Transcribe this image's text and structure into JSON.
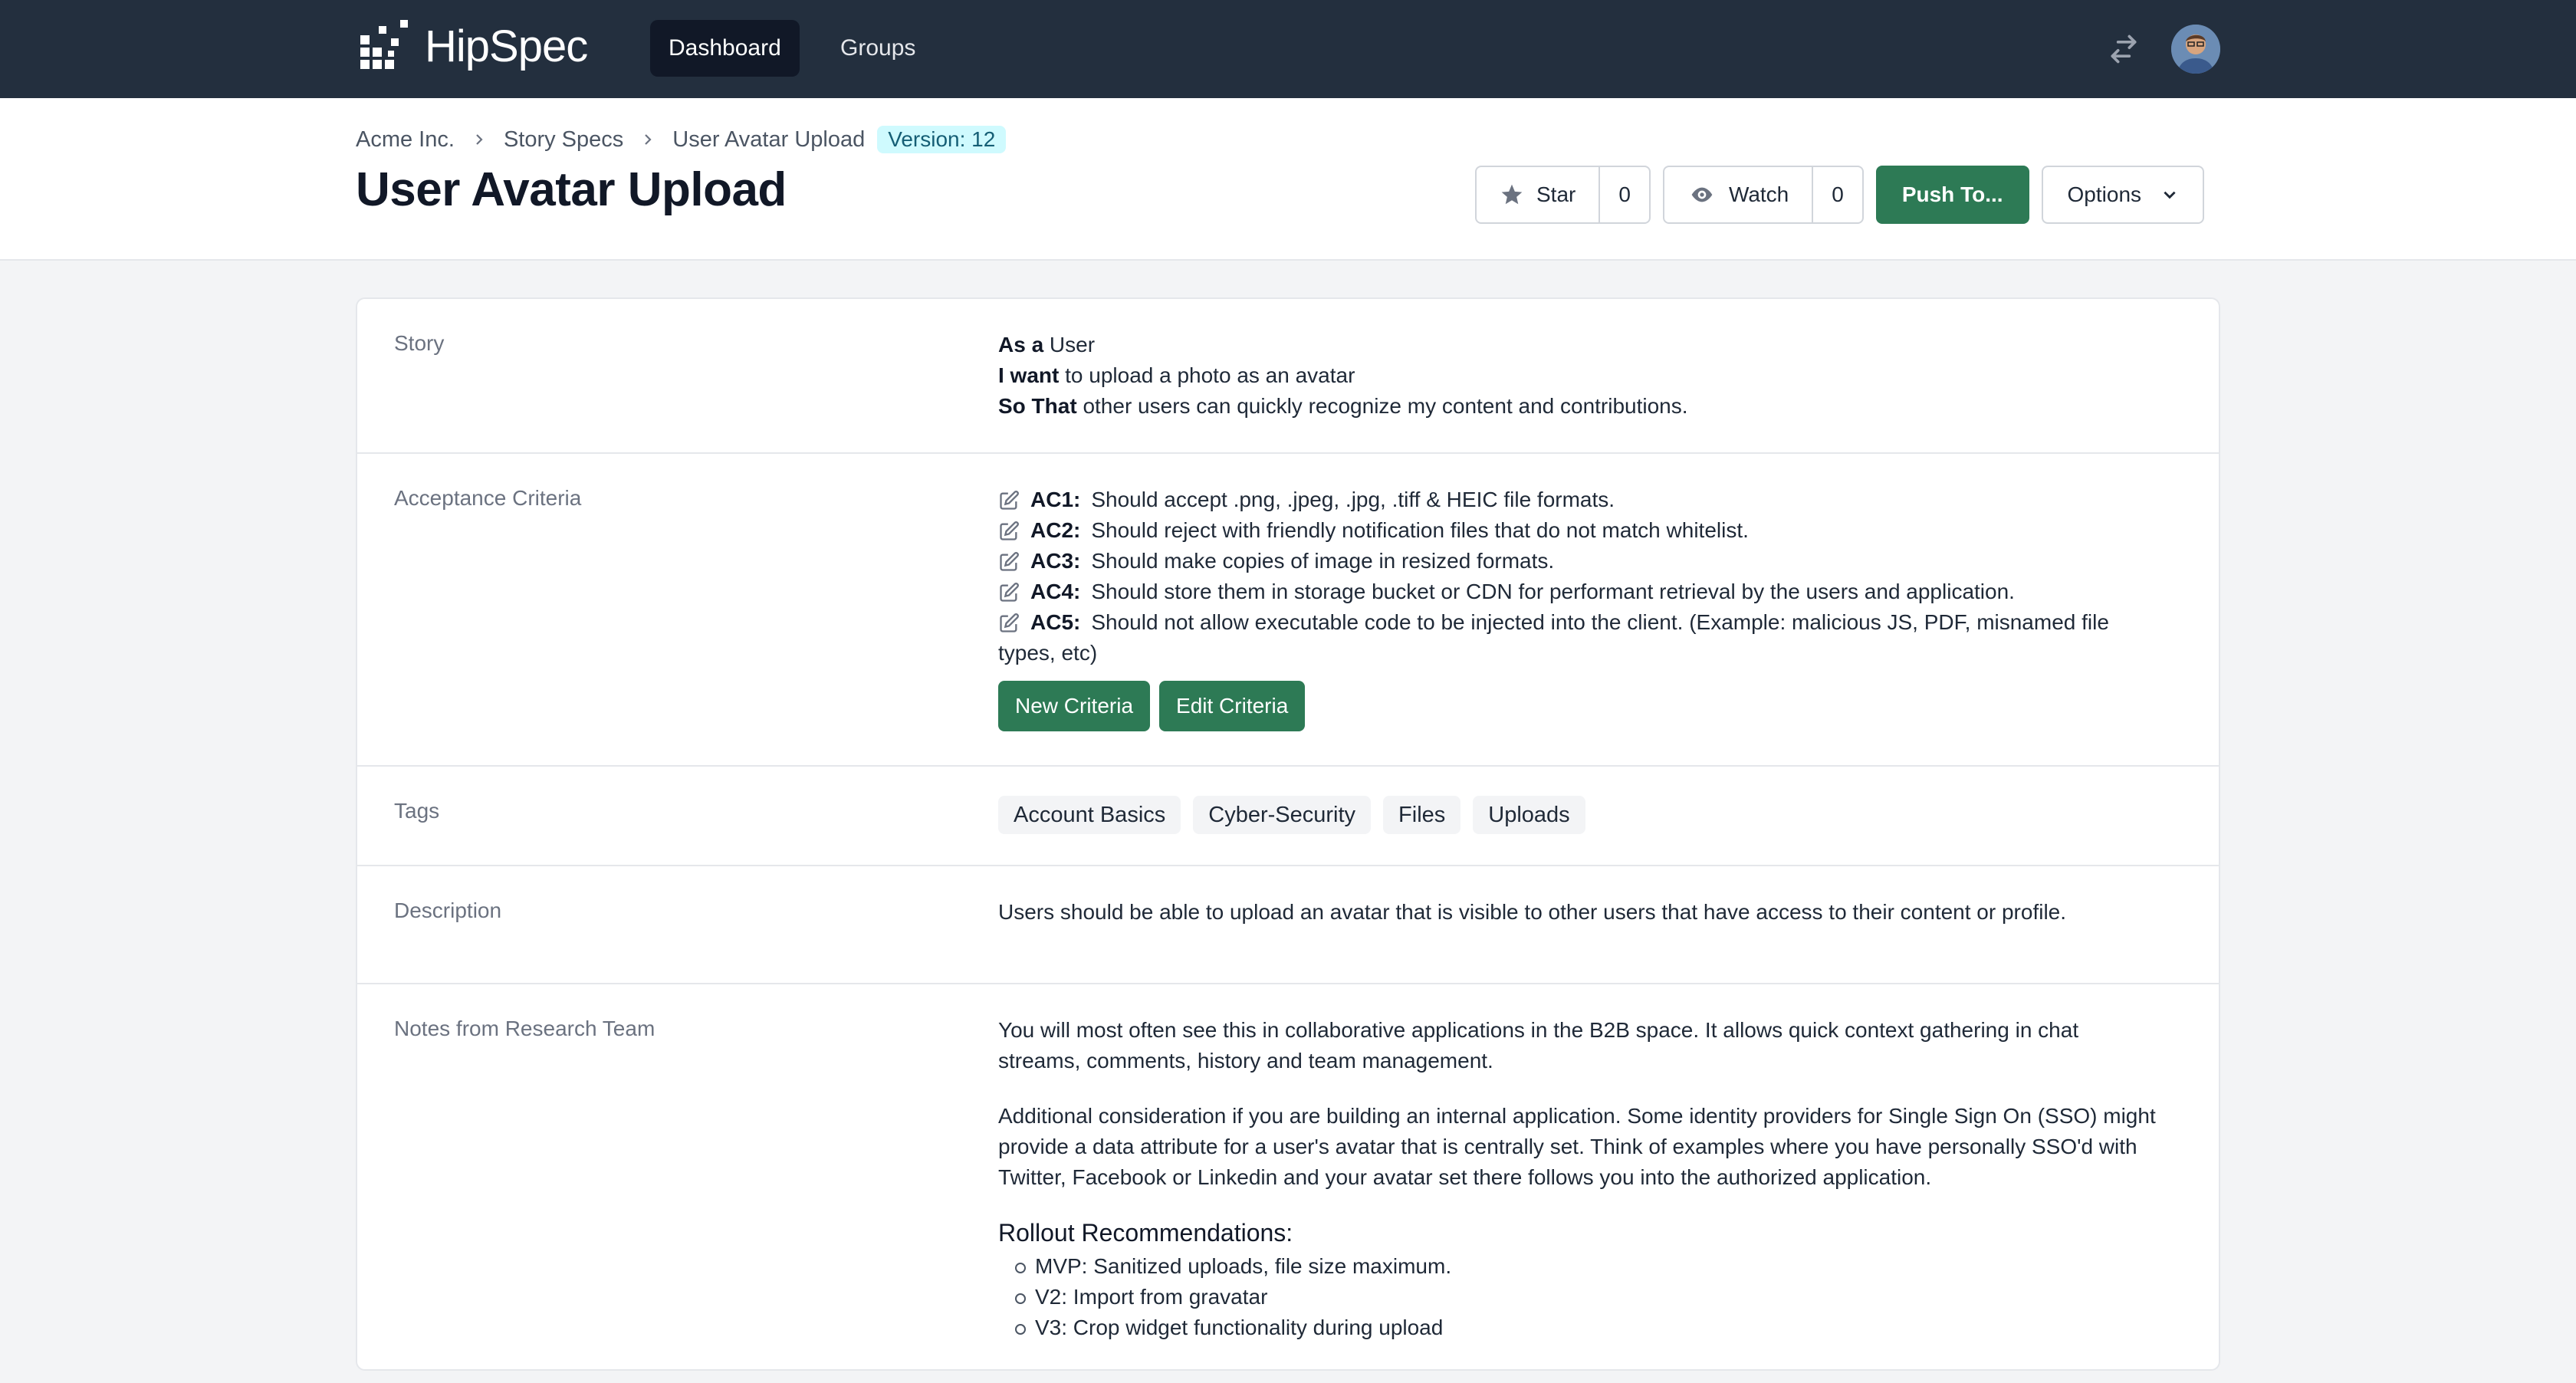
{
  "app": {
    "name": "HipSpec"
  },
  "nav": {
    "items": [
      {
        "label": "Dashboard"
      },
      {
        "label": "Groups"
      }
    ]
  },
  "breadcrumb": {
    "items": [
      "Acme Inc.",
      "Story Specs",
      "User Avatar Upload"
    ],
    "version": "Version: 12"
  },
  "page": {
    "title": "User Avatar Upload"
  },
  "actions": {
    "star_label": "Star",
    "star_count": "0",
    "watch_label": "Watch",
    "watch_count": "0",
    "push_label": "Push To...",
    "options_label": "Options"
  },
  "story": {
    "label": "Story",
    "as_a_kw": "As a",
    "as_a": " User",
    "i_want_kw": "I want",
    "i_want": " to upload a photo as an avatar",
    "so_that_kw": "So That",
    "so_that": " other users can quickly recognize my content and contributions."
  },
  "criteria": {
    "label": "Acceptance Criteria",
    "items": [
      {
        "id": "AC1:",
        "text": "Should accept .png, .jpeg, .jpg, .tiff & HEIC file formats."
      },
      {
        "id": "AC2:",
        "text": "Should reject with friendly notification files that do not match whitelist."
      },
      {
        "id": "AC3:",
        "text": "Should make copies of image in resized formats."
      },
      {
        "id": "AC4:",
        "text": "Should store them in storage bucket or CDN for performant retrieval by the users and application."
      },
      {
        "id": "AC5:",
        "text": "Should not allow executable code to be injected into the client. (Example: malicious JS, PDF, misnamed file types, etc)"
      }
    ],
    "new_label": "New Criteria",
    "edit_label": "Edit Criteria"
  },
  "tags": {
    "label": "Tags",
    "items": [
      "Account Basics",
      "Cyber-Security",
      "Files",
      "Uploads"
    ]
  },
  "description": {
    "label": "Description",
    "text": "Users should be able to upload an avatar that is visible to other users that have access to their content or profile."
  },
  "notes": {
    "label": "Notes from Research Team",
    "p1": "You will most often see this in collaborative applications in the B2B space. It allows quick context gathering in chat streams, comments, history and team management.",
    "p2": "Additional consideration if you are building an internal application. Some identity providers for Single Sign On (SSO) might provide a data attribute for a user's avatar that is centrally set. Think of examples where you have personally SSO'd with Twitter, Facebook or Linkedin and your avatar set there follows you into the authorized application.",
    "rollout_title": "Rollout Recommendations:",
    "rollout": [
      "MVP: Sanitized uploads, file size maximum.",
      "V2: Import from gravatar",
      "V3: Crop widget functionality during upload"
    ]
  },
  "colors": {
    "nav_bg": "#232f3e",
    "primary": "#2d7a55",
    "badge_bg": "#cffafe"
  },
  "icons": [
    "logo-icon",
    "swap-arrows-icon",
    "chevron-right-icon",
    "star-icon",
    "eye-icon",
    "chevron-down-icon",
    "edit-icon"
  ]
}
